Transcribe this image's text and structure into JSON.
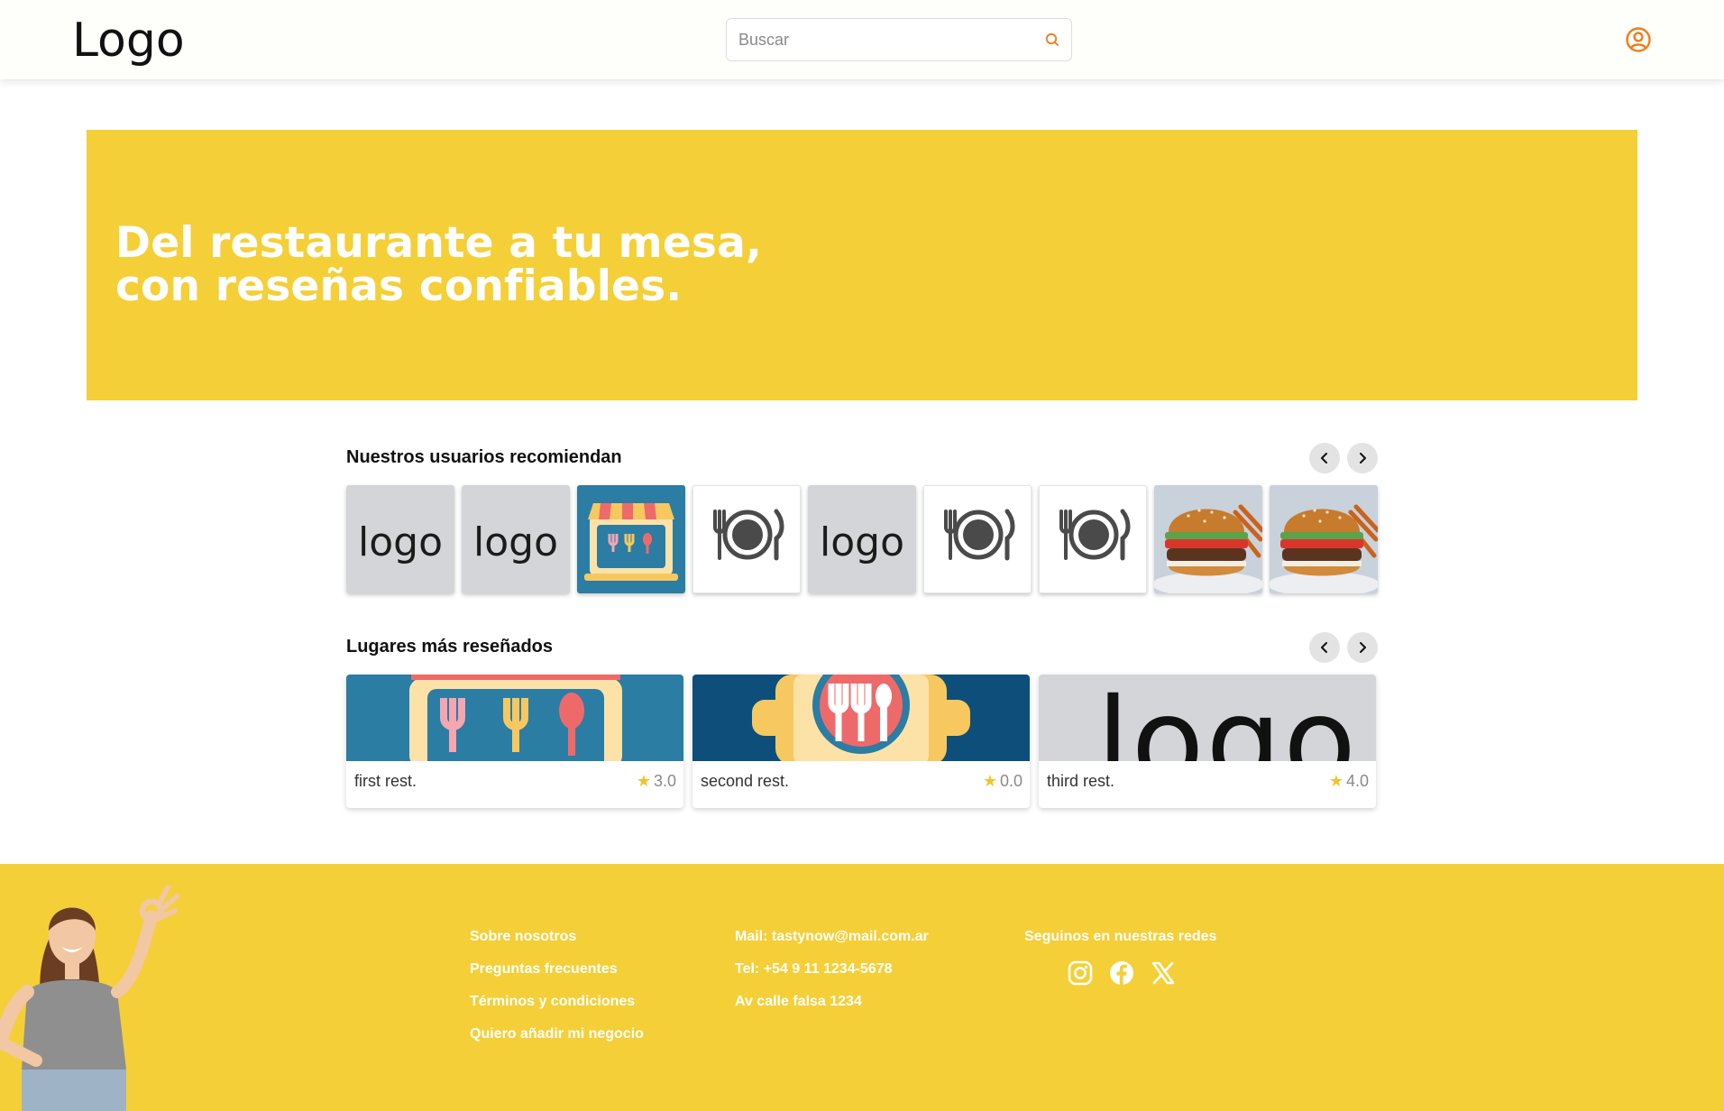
{
  "header": {
    "logo": "Logo",
    "search_placeholder": "Buscar",
    "search_icon": "search-icon",
    "user_icon": "user-circle-icon",
    "accent_color": "#f07c1a"
  },
  "hero": {
    "title_line1": "Del restaurante a tu mesa,",
    "title_line2": "con reseñas confiables.",
    "background": "#f5cf37"
  },
  "recommended": {
    "title": "Nuestros usuarios recomiendan",
    "prev_icon": "chevron-left-icon",
    "next_icon": "chevron-right-icon",
    "items": [
      {
        "kind": "text-logo",
        "text": "logo"
      },
      {
        "kind": "text-logo",
        "text": "logo"
      },
      {
        "kind": "storefront-icon"
      },
      {
        "kind": "plate-cutlery-icon"
      },
      {
        "kind": "text-logo",
        "text": "logo"
      },
      {
        "kind": "plate-cutlery-icon"
      },
      {
        "kind": "plate-cutlery-icon"
      },
      {
        "kind": "burger-photo"
      },
      {
        "kind": "burger-photo"
      }
    ]
  },
  "most_reviewed": {
    "title": "Lugares más reseñados",
    "prev_icon": "chevron-left-icon",
    "next_icon": "chevron-right-icon",
    "cards": [
      {
        "name": "first rest.",
        "rating": "3.0",
        "image": "storefront-illustration"
      },
      {
        "name": "second rest.",
        "rating": "0.0",
        "image": "restaurant-illustration"
      },
      {
        "name": "third rest.",
        "rating": "4.0",
        "image_text": "logo"
      }
    ],
    "star_color": "#f0c42b"
  },
  "footer": {
    "links": [
      "Sobre nosotros",
      "Preguntas frecuentes",
      "Términos y condiciones",
      "Quiero añadir mi negocio"
    ],
    "contact": [
      "Mail: tastynow@mail.com.ar",
      "Tel: +54 9 11 1234-5678",
      "Av calle falsa 1234"
    ],
    "social_title": "Seguinos en nuestras redes",
    "social_icons": [
      "instagram-icon",
      "facebook-icon",
      "x-icon"
    ],
    "background": "#f5cf37"
  }
}
